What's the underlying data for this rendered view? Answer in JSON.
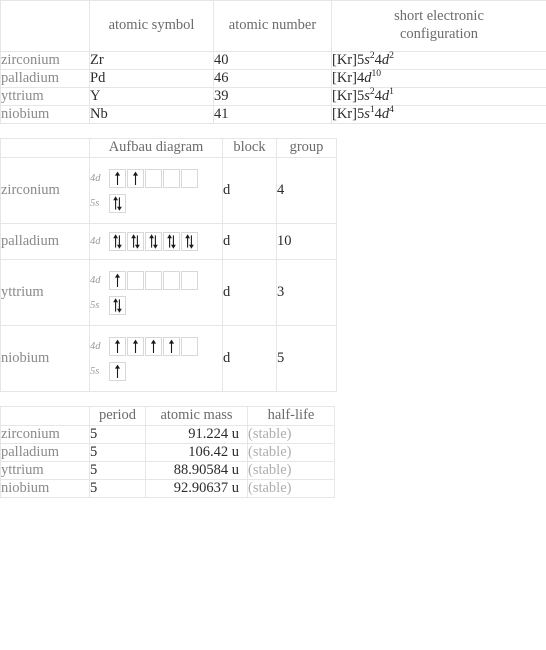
{
  "elements": [
    "zirconium",
    "palladium",
    "yttrium",
    "niobium"
  ],
  "table1": {
    "headers": [
      "",
      "atomic symbol",
      "atomic number",
      "short electronic configuration"
    ],
    "header_short_config_line1": "short electronic",
    "header_short_config_line2": "configuration",
    "rows": [
      {
        "label": "zirconium",
        "symbol": "Zr",
        "number": "40",
        "config_parts": [
          {
            "t": "[Kr]5",
            "i": false,
            "sup": ""
          },
          {
            "t": "s",
            "i": true,
            "sup": "2"
          },
          {
            "t": "4",
            "i": false,
            "sup": ""
          },
          {
            "t": "d",
            "i": true,
            "sup": "2"
          }
        ]
      },
      {
        "label": "palladium",
        "symbol": "Pd",
        "number": "46",
        "config_parts": [
          {
            "t": "[Kr]4",
            "i": false,
            "sup": ""
          },
          {
            "t": "d",
            "i": true,
            "sup": "10"
          }
        ]
      },
      {
        "label": "yttrium",
        "symbol": "Y",
        "number": "39",
        "config_parts": [
          {
            "t": "[Kr]5",
            "i": false,
            "sup": ""
          },
          {
            "t": "s",
            "i": true,
            "sup": "2"
          },
          {
            "t": "4",
            "i": false,
            "sup": ""
          },
          {
            "t": "d",
            "i": true,
            "sup": "1"
          }
        ]
      },
      {
        "label": "niobium",
        "symbol": "Nb",
        "number": "41",
        "config_parts": [
          {
            "t": "[Kr]5",
            "i": false,
            "sup": ""
          },
          {
            "t": "s",
            "i": true,
            "sup": "1"
          },
          {
            "t": "4",
            "i": false,
            "sup": ""
          },
          {
            "t": "d",
            "i": true,
            "sup": "4"
          }
        ]
      }
    ]
  },
  "table2": {
    "headers": [
      "",
      "Aufbau diagram",
      "block",
      "group"
    ],
    "rows": [
      {
        "label": "zirconium",
        "block": "d",
        "group": "4",
        "orbitals": [
          {
            "name": "4d",
            "boxes": [
              "up",
              "up",
              "empty",
              "empty",
              "empty"
            ]
          },
          {
            "name": "5s",
            "boxes": [
              "updown"
            ]
          }
        ]
      },
      {
        "label": "palladium",
        "block": "d",
        "group": "10",
        "orbitals": [
          {
            "name": "4d",
            "boxes": [
              "updown",
              "updown",
              "updown",
              "updown",
              "updown"
            ]
          }
        ]
      },
      {
        "label": "yttrium",
        "block": "d",
        "group": "3",
        "orbitals": [
          {
            "name": "4d",
            "boxes": [
              "up",
              "empty",
              "empty",
              "empty",
              "empty"
            ]
          },
          {
            "name": "5s",
            "boxes": [
              "updown"
            ]
          }
        ]
      },
      {
        "label": "niobium",
        "block": "d",
        "group": "5",
        "orbitals": [
          {
            "name": "4d",
            "boxes": [
              "up",
              "up",
              "up",
              "up",
              "empty"
            ]
          },
          {
            "name": "5s",
            "boxes": [
              "up"
            ]
          }
        ]
      }
    ]
  },
  "table3": {
    "headers": [
      "",
      "period",
      "atomic mass",
      "half-life"
    ],
    "rows": [
      {
        "label": "zirconium",
        "period": "5",
        "mass": "91.224 u",
        "halflife": "(stable)"
      },
      {
        "label": "palladium",
        "period": "5",
        "mass": "106.42 u",
        "halflife": "(stable)"
      },
      {
        "label": "yttrium",
        "period": "5",
        "mass": "88.90584 u",
        "halflife": "(stable)"
      },
      {
        "label": "niobium",
        "period": "5",
        "mass": "92.90637 u",
        "halflife": "(stable)"
      }
    ]
  },
  "colors": {
    "border": "#e6e6e6",
    "box_border": "#d8d8d8",
    "header_text": "#6b6b6b",
    "row_label_text": "#8a8a8a",
    "value_text": "#2b2b2b",
    "muted_text": "#aeaeae",
    "orbital_label": "#9a9a9a",
    "arrow": "#1a1a1a",
    "background": "#ffffff"
  }
}
